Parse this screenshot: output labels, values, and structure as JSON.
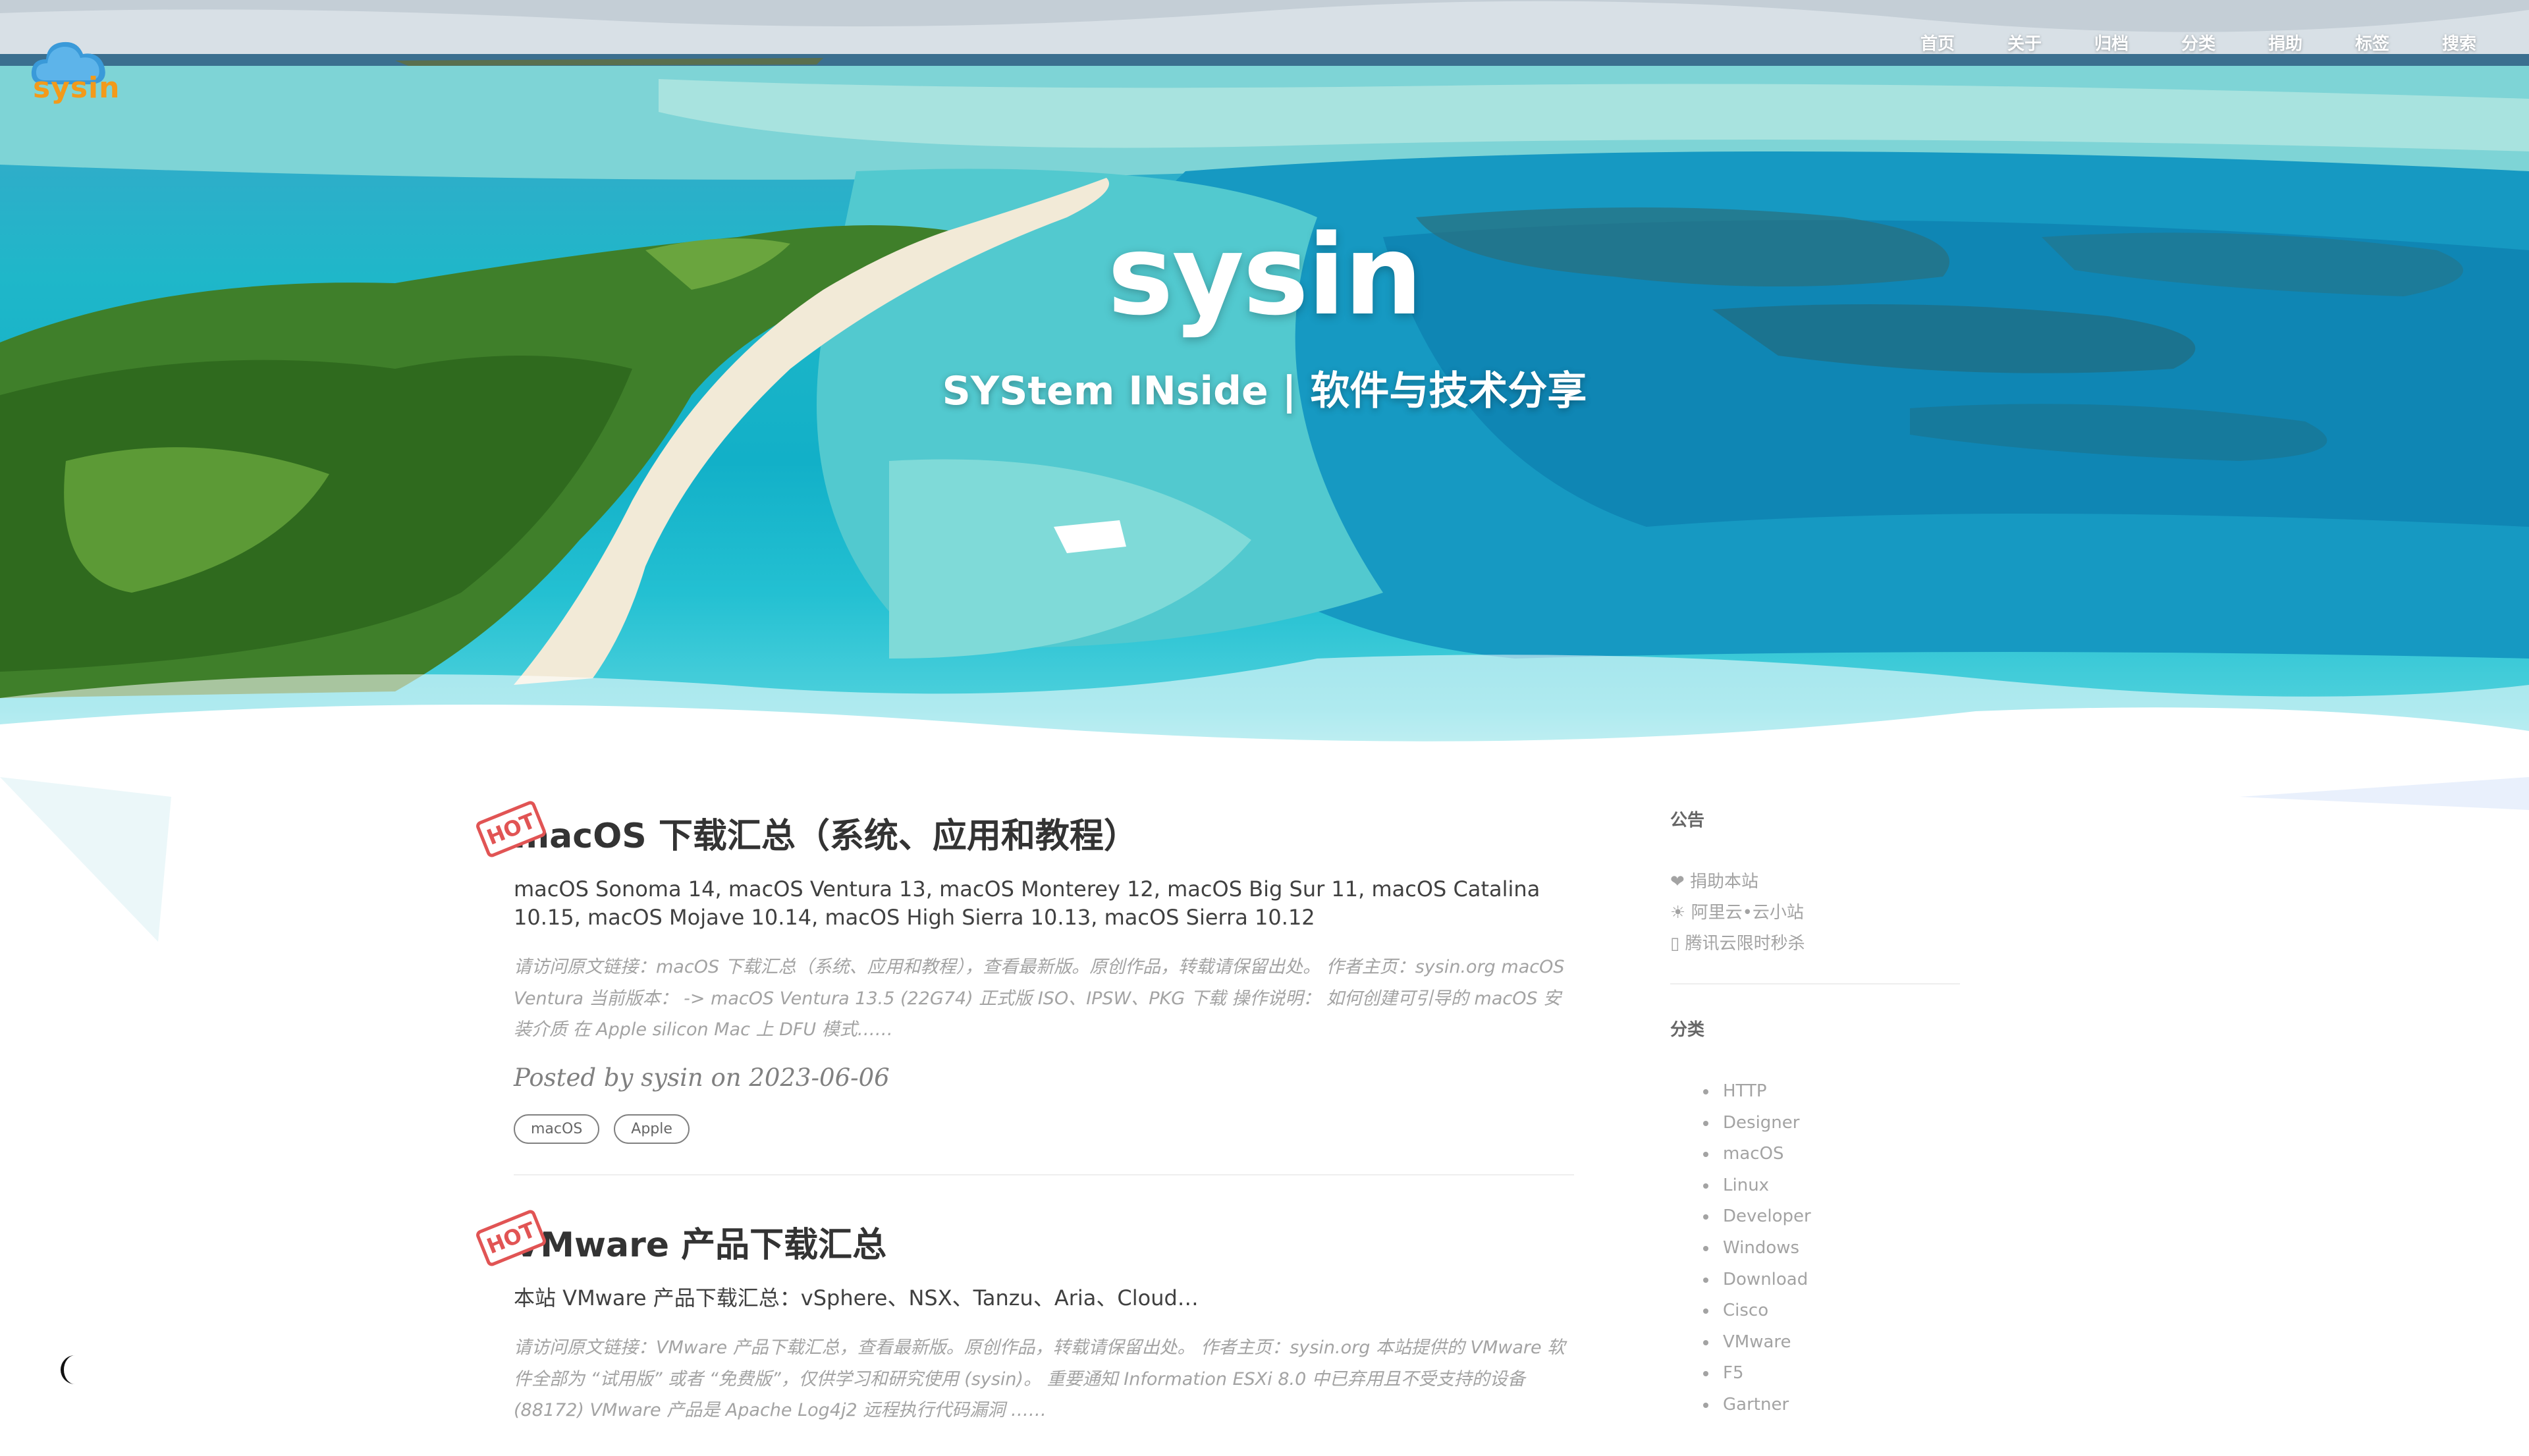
{
  "header": {
    "logo_text": "sysin",
    "nav": [
      "首页",
      "关于",
      "归档",
      "分类",
      "捐助",
      "标签",
      "搜索"
    ]
  },
  "hero": {
    "title": "sysin",
    "subtitle": "SYStem INside | 软件与技术分享"
  },
  "posts": [
    {
      "badge": "HOT",
      "title": "macOS 下载汇总（系统、应用和教程）",
      "subtitle": "macOS Sonoma 14, macOS Ventura 13, macOS Monterey 12, macOS Big Sur 11, macOS Catalina 10.15, macOS Mojave 10.14, macOS High Sierra 10.13, macOS Sierra 10.12",
      "excerpt": "请访问原文链接：macOS 下载汇总（系统、应用和教程），查看最新版。原创作品，转载请保留出处。 作者主页：sysin.org macOS Ventura 当前版本： -> macOS Ventura 13.5 (22G74) 正式版 ISO、IPSW、PKG 下载 操作说明： 如何创建可引导的 macOS 安装介质 在 Apple silicon Mac 上 DFU 模式……",
      "meta": "Posted by sysin on 2023-06-06",
      "tags": [
        "macOS",
        "Apple"
      ]
    },
    {
      "badge": "HOT",
      "title": "VMware 产品下载汇总",
      "subtitle": "本站 VMware 产品下载汇总：vSphere、NSX、Tanzu、Aria、Cloud…",
      "excerpt": "请访问原文链接：VMware 产品下载汇总，查看最新版。原创作品，转载请保留出处。 作者主页：sysin.org 本站提供的 VMware 软件全部为 “试用版” 或者 “免费版”，仅供学习和研究使用 (sysin)。 重要通知 Information ESXi 8.0 中已弃用且不受支持的设备 (88172) VMware 产品是 Apache Log4j2 远程执行代码漏洞 ……"
    }
  ],
  "sidebar": {
    "notice_heading": "公告",
    "notice_links": [
      "❤ 捐助本站",
      "☀ 阿里云•云小站",
      "▯ 腾讯云限时秒杀"
    ],
    "category_heading": "分类",
    "categories": [
      "HTTP",
      "Designer",
      "macOS",
      "Linux",
      "Developer",
      "Windows",
      "Download",
      "Cisco",
      "VMware",
      "F5",
      "Gartner"
    ]
  },
  "colors": {
    "logo_orange": "#f39a1a",
    "logo_blue": "#3a9ad9",
    "hot_red": "#e15454"
  },
  "icons": {
    "theme_toggle": "moon-icon",
    "logo": "cloud-icon"
  }
}
